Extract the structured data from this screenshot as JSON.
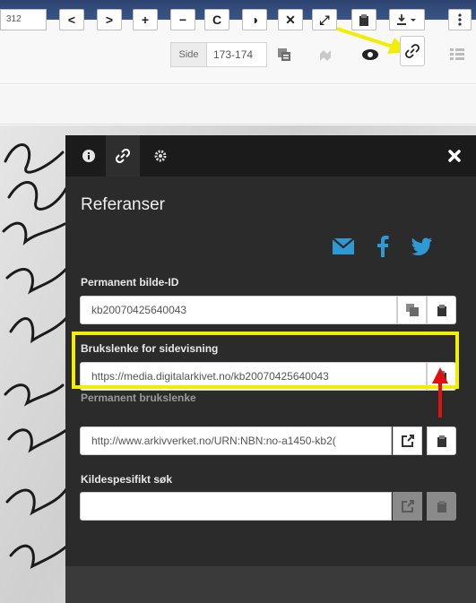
{
  "header": {
    "page_label": "Side",
    "page_value": "173-174",
    "icons": [
      "copy-icon",
      "puzzle-icon",
      "eye-icon",
      "link-icon",
      "grid-icon"
    ]
  },
  "toolbar": {
    "page_number": "312",
    "buttons": [
      "<",
      ">",
      "+",
      "−",
      "C",
      "◑",
      "✕",
      "⤢",
      "clipboard",
      "download",
      "more"
    ]
  },
  "panel": {
    "tabs": [
      "info-icon",
      "link-icon",
      "gear-icon"
    ],
    "title": "Referanser",
    "share": [
      "email-icon",
      "facebook-icon",
      "twitter-icon"
    ],
    "fields": [
      {
        "label": "Permanent bilde-ID",
        "value": "kb20070425640043"
      },
      {
        "label": "Brukslenke for sidevisning",
        "value": "https://media.digitalarkivet.no/kb20070425640043"
      },
      {
        "label": "Permanent brukslenke",
        "value": "http://www.arkivverket.no/URN:NBN:no-a1450-kb2("
      },
      {
        "label": "Kildespesifikt søk",
        "value": ""
      }
    ]
  },
  "annotations": {
    "highlight_color": "#f2ee00",
    "yellow_arrow_color": "#f2ee00",
    "red_arrow_color": "#e01010"
  },
  "colors": {
    "panel_bg": "#2b2b2b",
    "share_blue": "#2d9ad6",
    "header_bg": "#f8f8f8"
  }
}
